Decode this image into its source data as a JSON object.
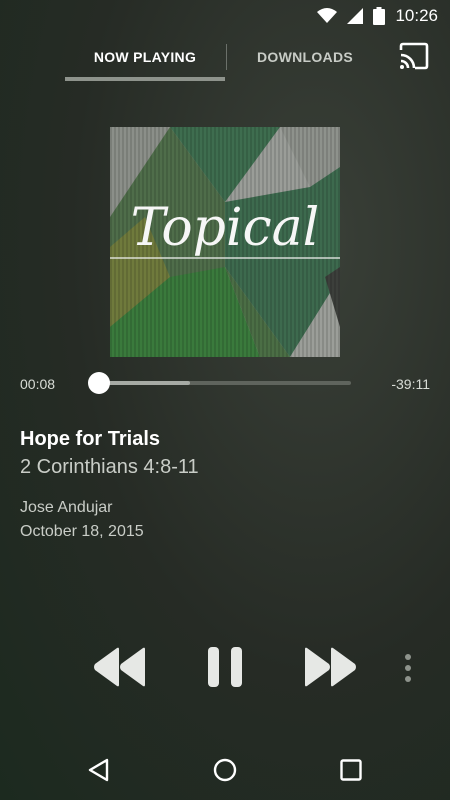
{
  "status_bar": {
    "time": "10:26",
    "icons": [
      "wifi-icon",
      "signal-icon",
      "battery-icon"
    ]
  },
  "tabs": [
    {
      "label": "NOW PLAYING",
      "active": true
    },
    {
      "label": "DOWNLOADS",
      "active": false
    }
  ],
  "album_art": {
    "text": "Topical"
  },
  "player": {
    "elapsed": "00:08",
    "remaining": "-39:11",
    "buffered_fraction": 0.36,
    "progress_fraction": 0.0
  },
  "track": {
    "title": "Hope for Trials",
    "subtitle": "2 Corinthians 4:8-11",
    "speaker": "Jose Andujar",
    "date": "October 18, 2015"
  },
  "controls": [
    "rewind-icon",
    "pause-icon",
    "fast-forward-icon",
    "more-vert-icon"
  ],
  "nav_bar": [
    "back-icon",
    "home-icon",
    "recents-icon"
  ],
  "colors": {
    "background": "#262b25",
    "accent_green": "#3f6b46",
    "tab_indicator": "#8e938c"
  }
}
